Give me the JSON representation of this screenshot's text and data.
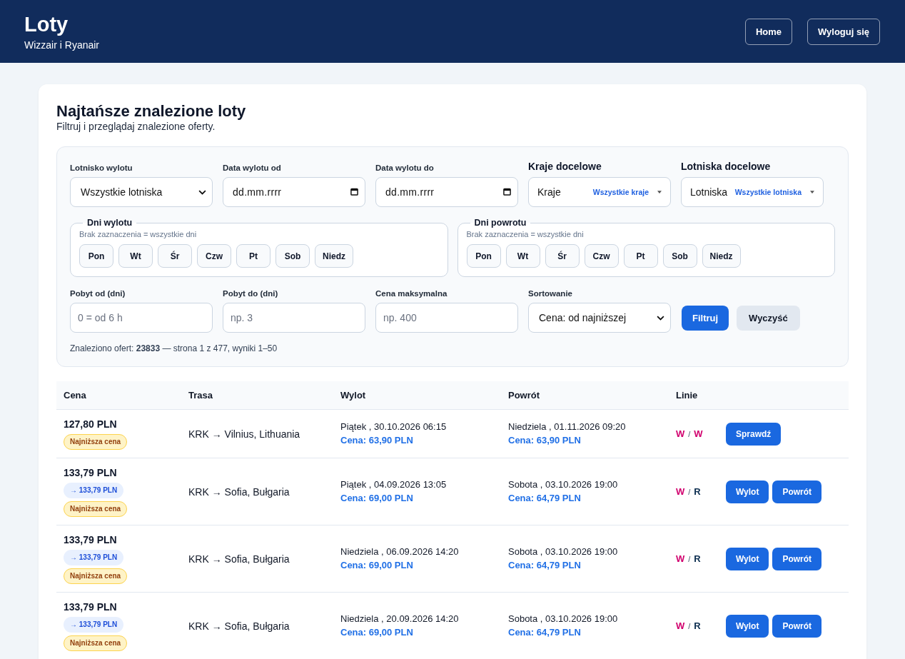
{
  "header": {
    "title": "Loty",
    "subtitle": "Wizzair i Ryanair",
    "buttons": [
      "Home",
      "Wyloguj się"
    ]
  },
  "page": {
    "title": "Najtańsze znalezione loty",
    "subtitle": "Filtruj i przeglądaj znalezione oferty."
  },
  "filters": {
    "row_1": [
      {
        "kind": "select",
        "label": "Lotnisko wylotu",
        "value": "Wszystkie lotniska"
      },
      {
        "kind": "date",
        "label": "Data wylotu od",
        "placeholder": "dd.mm.rrrr"
      },
      {
        "kind": "date",
        "label": "Data wylotu do",
        "placeholder": "dd.mm.rrrr"
      },
      {
        "kind": "multiselect",
        "label": "Kraje docelowe",
        "prefix": "Kraje",
        "value": "Wszystkie kraje"
      },
      {
        "kind": "multiselect",
        "label": "Lotniska docelowe",
        "prefix": "Lotniska",
        "value": "Wszystkie lotniska"
      }
    ],
    "day_groups": [
      {
        "legend": "Dni wylotu",
        "hint": "Brak zaznaczenia = wszystkie dni",
        "days": [
          {
            "label": "Pon",
            "selected": false
          },
          {
            "label": "Wt",
            "selected": false
          },
          {
            "label": "Śr",
            "selected": false
          },
          {
            "label": "Czw",
            "selected": false
          },
          {
            "label": "Pt",
            "selected": false
          },
          {
            "label": "Sob",
            "selected": false
          },
          {
            "label": "Niedz",
            "selected": false
          }
        ]
      },
      {
        "legend": "Dni powrotu",
        "hint": "Brak zaznaczenia = wszystkie dni",
        "days": [
          {
            "label": "Pon",
            "selected": false
          },
          {
            "label": "Wt",
            "selected": false
          },
          {
            "label": "Śr",
            "selected": false
          },
          {
            "label": "Czw",
            "selected": false
          },
          {
            "label": "Pt",
            "selected": false
          },
          {
            "label": "Sob",
            "selected": false
          },
          {
            "label": "Niedz",
            "selected": false
          }
        ]
      }
    ],
    "row_3": [
      {
        "kind": "number",
        "label": "Pobyt od (dni)",
        "placeholder": "0 = od 6 h"
      },
      {
        "kind": "number",
        "label": "Pobyt do (dni)",
        "placeholder": "np. 3"
      },
      {
        "kind": "number",
        "label": "Cena maksymalna",
        "placeholder": "np. 400"
      },
      {
        "kind": "select",
        "label": "Sortowanie",
        "value": "Cena: od najniższej"
      }
    ],
    "buttons": [
      {
        "kind": "primary",
        "label": "Filtruj"
      },
      {
        "kind": "secondary",
        "label": "Wyczyść"
      }
    ],
    "summary": "Znaleziono ofert: **23833** — strona 1 z 477, wyniki 1–50"
  },
  "table": {
    "columns": [
      "Cena",
      "Trasa",
      "Wylot",
      "Powrót",
      "Linie"
    ],
    "rows": [
      {
        "price": "127,80 PLN",
        "badges": [
          {
            "kind": "lowest",
            "text": "Najniższa cena"
          }
        ],
        "route": "KRK → Vilnius, Lithuania",
        "departure": {
          "date": "Piątek , 30.10.2026 06:15",
          "price": "Cena: 63,90 PLN"
        },
        "return": {
          "date": "Niedziela , 01.11.2026 09:20",
          "price": "Cena: 63,90 PLN"
        },
        "airlines": [
          {
            "code": "W",
            "color": "#d1006e"
          },
          {
            "code": "W",
            "color": "#d1006e"
          }
        ],
        "airline_separator": "/",
        "actions": [
          "Sprawdź"
        ]
      },
      {
        "price": "133,79 PLN",
        "badges": [
          {
            "kind": "route",
            "text": "→ 133,79 PLN"
          },
          {
            "kind": "lowest",
            "text": "Najniższa cena"
          }
        ],
        "route": "KRK → Sofia, Bułgaria",
        "departure": {
          "date": "Piątek , 04.09.2026 13:05",
          "price": "Cena: 69,00 PLN"
        },
        "return": {
          "date": "Sobota , 03.10.2026 19:00",
          "price": "Cena: 64,79 PLN"
        },
        "airlines": [
          {
            "code": "W",
            "color": "#d1006e"
          },
          {
            "code": "R",
            "color": "#0b2d4f"
          }
        ],
        "airline_separator": "/",
        "actions": [
          "Wylot",
          "Powrót"
        ]
      },
      {
        "price": "133,79 PLN",
        "badges": [
          {
            "kind": "route",
            "text": "→ 133,79 PLN"
          },
          {
            "kind": "lowest",
            "text": "Najniższa cena"
          }
        ],
        "route": "KRK → Sofia, Bułgaria",
        "departure": {
          "date": "Niedziela , 06.09.2026 14:20",
          "price": "Cena: 69,00 PLN"
        },
        "return": {
          "date": "Sobota , 03.10.2026 19:00",
          "price": "Cena: 64,79 PLN"
        },
        "airlines": [
          {
            "code": "W",
            "color": "#d1006e"
          },
          {
            "code": "R",
            "color": "#0b2d4f"
          }
        ],
        "airline_separator": "/",
        "actions": [
          "Wylot",
          "Powrót"
        ]
      },
      {
        "price": "133,79 PLN",
        "badges": [
          {
            "kind": "route",
            "text": "→ 133,79 PLN"
          },
          {
            "kind": "lowest",
            "text": "Najniższa cena"
          }
        ],
        "route": "KRK → Sofia, Bułgaria",
        "departure": {
          "date": "Niedziela , 20.09.2026 14:20",
          "price": "Cena: 69,00 PLN"
        },
        "return": {
          "date": "Sobota , 03.10.2026 19:00",
          "price": "Cena: 64,79 PLN"
        },
        "airlines": [
          {
            "code": "W",
            "color": "#d1006e"
          },
          {
            "code": "R",
            "color": "#0b2d4f"
          }
        ],
        "airline_separator": "/",
        "actions": [
          "Wylot",
          "Powrót"
        ]
      }
    ]
  }
}
